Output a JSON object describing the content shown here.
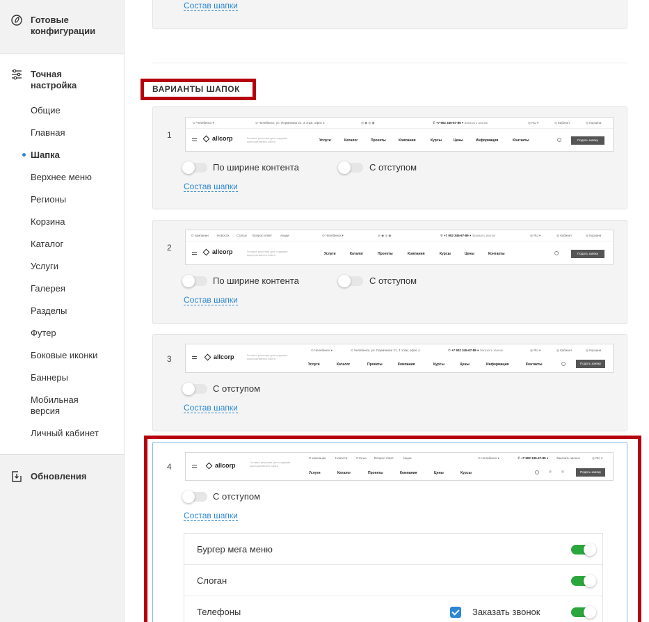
{
  "sidebar": {
    "sections": {
      "configs": "Готовые конфигурации",
      "fine": "Точная настройка",
      "updates": "Обновления"
    },
    "items": [
      "Общие",
      "Главная",
      "Шапка",
      "Верхнее меню",
      "Регионы",
      "Корзина",
      "Каталог",
      "Услуги",
      "Галерея",
      "Разделы",
      "Футер",
      "Боковые иконки",
      "Баннеры",
      "Мобильная версия",
      "Личный кабинет"
    ],
    "active": "Шапка"
  },
  "top_link": "Состав шапки",
  "heading": "ВАРИАНТЫ ШАПОК",
  "variants": [
    {
      "num": "1",
      "toggles": [
        "По ширине контента",
        "С отступом"
      ],
      "link": "Состав шапки"
    },
    {
      "num": "2",
      "toggles": [
        "По ширине контента",
        "С отступом"
      ],
      "link": "Состав шапки"
    },
    {
      "num": "3",
      "toggles": [
        "С отступом"
      ],
      "link": "Состав шапки"
    },
    {
      "num": "4",
      "toggles": [
        "С отступом"
      ],
      "link": "Состав шапки"
    }
  ],
  "preview": {
    "city": "Челябинск",
    "address": "Челябинск, ул. Пермякова 21, 3 этаж, офис 4",
    "phone": "+7 902 345-67-89",
    "callback": "Заказать звонок",
    "lang": "RU",
    "cabinet": "Кабинет",
    "cart": "Корзина",
    "logo": "allcorp",
    "slogan": "Готовое решение для создания корпоративного сайта",
    "button": "Подать заявку",
    "nav1": [
      "Услуги",
      "Каталог",
      "Проекты",
      "Компания",
      "Курсы",
      "Цены",
      "Информация",
      "Контакты"
    ],
    "nav2": [
      "Услуги",
      "Каталог",
      "Проекты",
      "Компания",
      "Курсы",
      "Цены",
      "Контакты"
    ],
    "nav4": [
      "Услуги",
      "Каталог",
      "Проекты",
      "Компания",
      "Цены",
      "Курсы"
    ],
    "top2": [
      "О компании",
      "Новости",
      "Статьи",
      "Вопрос-ответ",
      "Акции"
    ],
    "top4": [
      "О компании",
      "Новости",
      "Статьи",
      "Вопрос-ответ",
      "Акции"
    ]
  },
  "options": [
    {
      "label": "Бургер мега меню",
      "enabled": true
    },
    {
      "label": "Слоган",
      "enabled": true
    },
    {
      "label": "Телефоны",
      "enabled": true,
      "extra_label": "Заказать звонок",
      "extra_checked": true
    }
  ]
}
